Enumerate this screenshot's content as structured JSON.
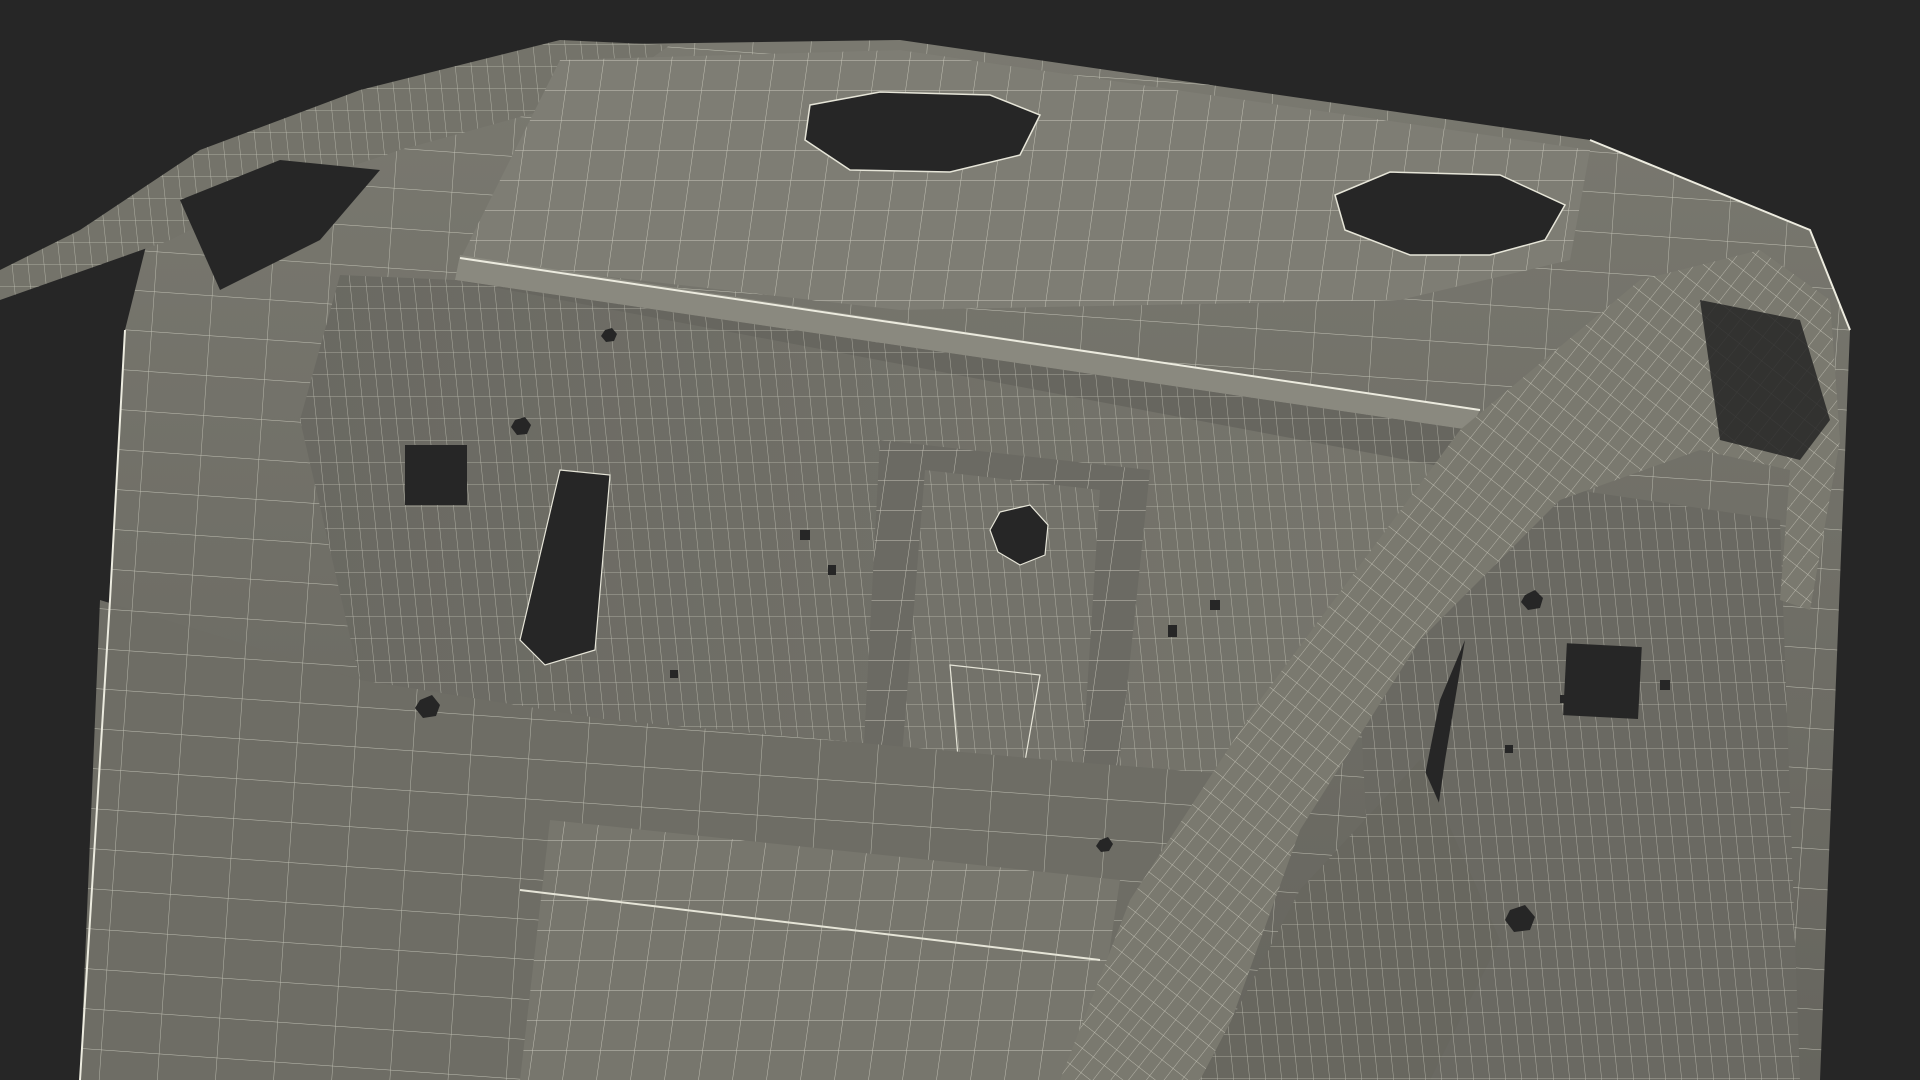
{
  "scene": {
    "subject": "car-rear-floor-panel-wireframe",
    "colors": {
      "background": "#262626",
      "surface": "#6f6e66",
      "surface_light": "#7c7b72",
      "surface_dark": "#5b5a53",
      "wire": "#e6e5d8",
      "hole": "#262626"
    }
  }
}
